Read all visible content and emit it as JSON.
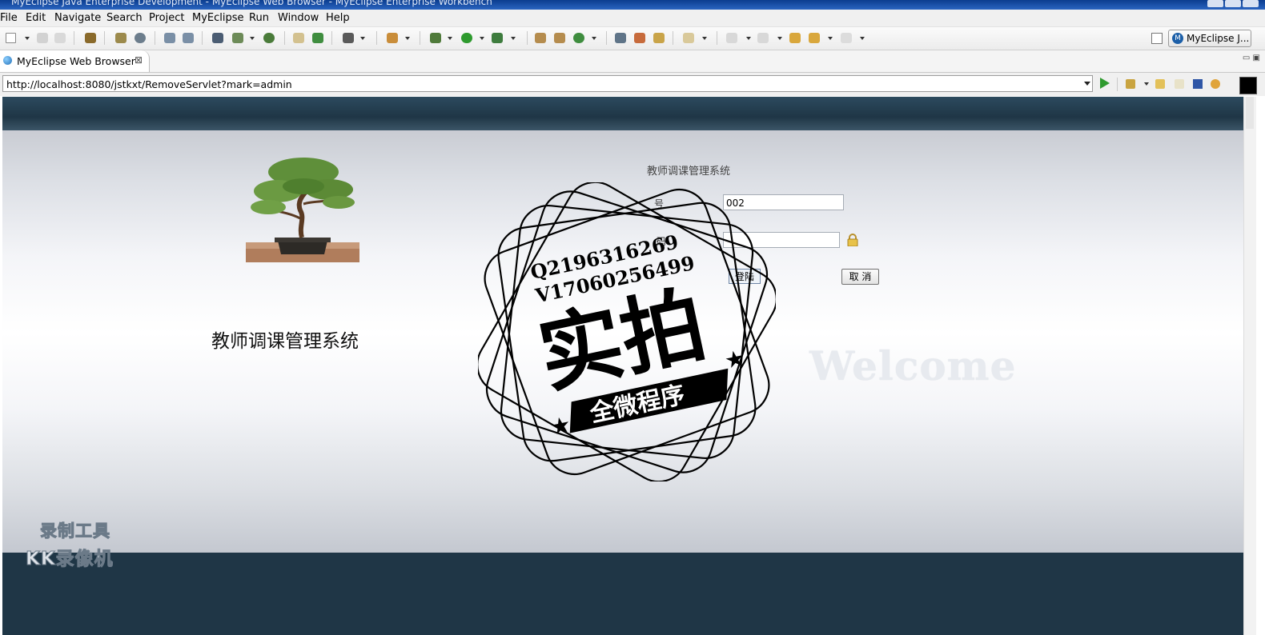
{
  "window": {
    "title": "MyEclipse Java Enterprise Development - MyEclipse Web Browser - MyEclipse Enterprise Workbench"
  },
  "menu": [
    "File",
    "Edit",
    "Navigate",
    "Search",
    "Project",
    "MyEclipse",
    "Run",
    "Window",
    "Help"
  ],
  "toolbar": {
    "perspective_label": "MyEclipse J..."
  },
  "editor_tab": {
    "label": "MyEclipse Web Browser",
    "close_glyph": "⊠"
  },
  "address_bar": {
    "url": "http://localhost:8080/jstkxt/RemoveServlet?mark=admin"
  },
  "web_page": {
    "system_name": "教师调课管理系统",
    "form_title": "教师调课管理系统",
    "username_label": "号",
    "username_value": "002",
    "password_label": "码",
    "login_button": "登陆",
    "cancel_button": "取 消",
    "welcome_text": "Welcome"
  },
  "watermark": {
    "qq": "Q2196316269",
    "vx": "V17060256499",
    "main": "实拍",
    "banner": "全微程序"
  },
  "recorder_watermark": {
    "line1": "录制工具",
    "line2": "KK录像机"
  },
  "colors": {
    "page_header": "#1f3646",
    "go_button": "#2e9a2e",
    "titlebar": "#0b3d8f"
  },
  "icons": [
    "new-icon",
    "save-icon",
    "print-icon",
    "package-icon",
    "debug-icon",
    "run-icon",
    "search-icon",
    "back-icon",
    "forward-icon",
    "refresh-icon",
    "stop-icon",
    "lock-icon",
    "globe-icon"
  ]
}
